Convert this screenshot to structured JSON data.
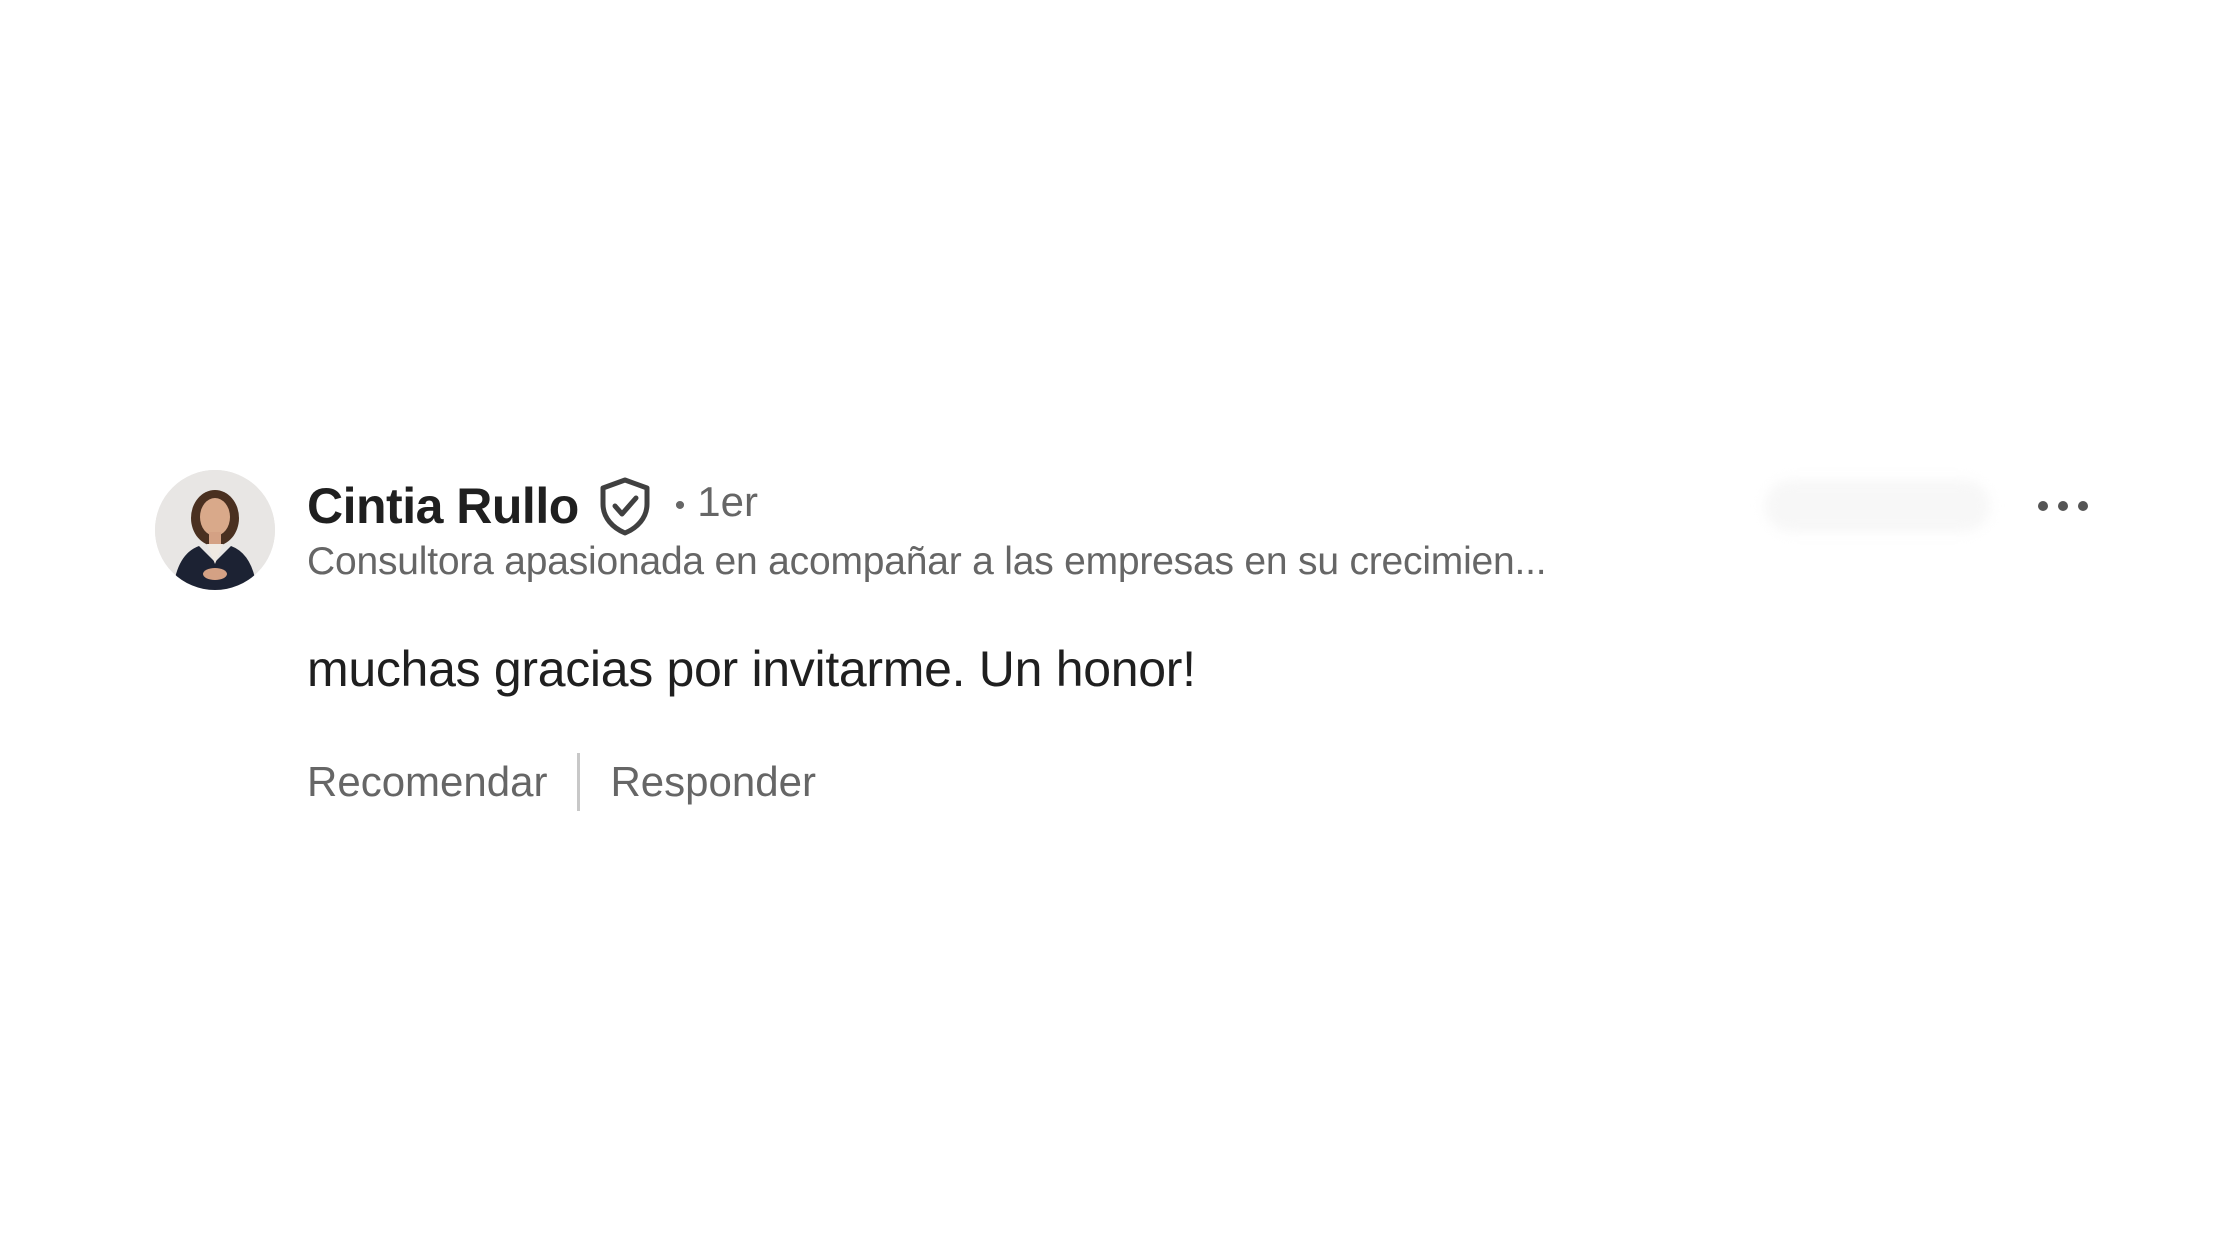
{
  "comment": {
    "author": {
      "name": "Cintia Rullo",
      "connection_degree": "1er",
      "headline": "Consultora apasionada en acompañar a las empresas en su crecimien..."
    },
    "separator": "•",
    "text": "muchas gracias por invitarme. Un honor!",
    "actions": {
      "recommend_label": "Recomendar",
      "reply_label": "Responder"
    }
  },
  "icons": {
    "avatar": "avatar",
    "verified": "verified-shield-icon",
    "more": "more-options-icon"
  },
  "colors": {
    "primary_text": "#1f1f1f",
    "secondary_text": "#666666",
    "divider": "#c8c8c8",
    "background": "#ffffff"
  }
}
